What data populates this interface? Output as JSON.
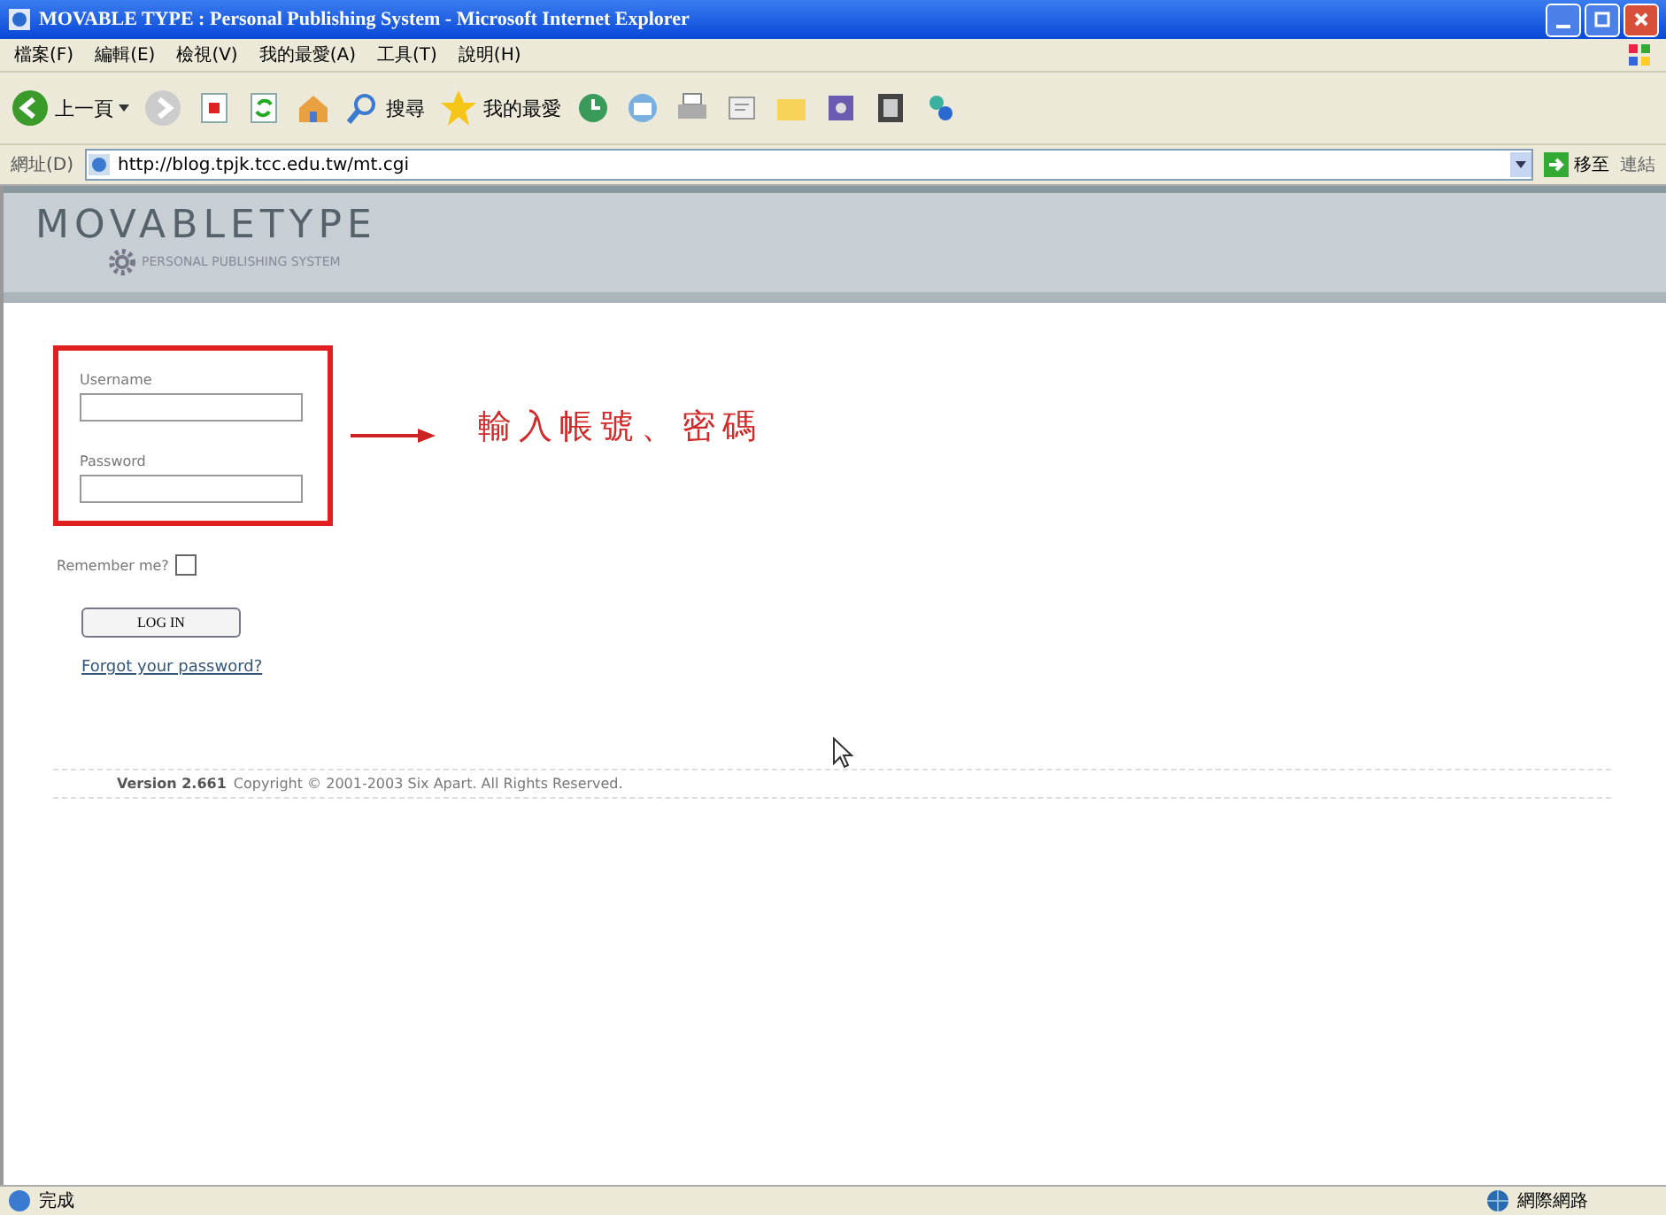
{
  "window": {
    "title": "MOVABLE TYPE : Personal Publishing System - Microsoft Internet Explorer"
  },
  "menu": [
    "檔案(F)",
    "編輯(E)",
    "檢視(V)",
    "我的最愛(A)",
    "工具(T)",
    "說明(H)"
  ],
  "toolbar": {
    "back": "上一頁",
    "search": "搜尋",
    "favorites": "我的最愛"
  },
  "address_bar": {
    "label": "網址(D)",
    "url": "http://blog.tpjk.tcc.edu.tw/mt.cgi",
    "go": "移至",
    "links": "連結"
  },
  "page": {
    "logo": "MOVABLETYPE",
    "tagline": "PERSONAL PUBLISHING SYSTEM",
    "fields": [
      {
        "label": "Username"
      },
      {
        "label": "Password"
      }
    ],
    "remember": {
      "label": "Remember me?",
      "checked": false
    },
    "login_button": "LOG IN",
    "forgot_link": "Forgot your password?",
    "annotation": "輸入帳號、密碼",
    "footer_version": "Version 2.661",
    "footer": "Copyright © 2001-2003 Six Apart. All Rights Reserved."
  },
  "status_bar": {
    "status": "完成",
    "zone": "網際網路"
  }
}
